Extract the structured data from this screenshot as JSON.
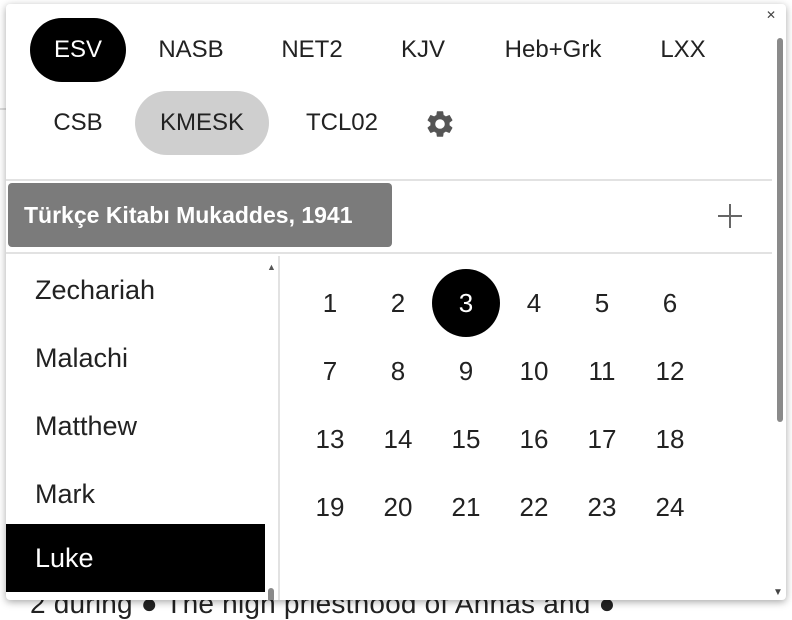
{
  "background": {
    "text": "2 during ● The high priesthood of Annas and ●"
  },
  "translations": [
    {
      "label": "ESV",
      "state": "active"
    },
    {
      "label": "NASB",
      "state": ""
    },
    {
      "label": "NET2",
      "state": ""
    },
    {
      "label": "KJV",
      "state": ""
    },
    {
      "label": "Heb+Grk",
      "state": ""
    },
    {
      "label": "LXX",
      "state": ""
    },
    {
      "label": "CSB",
      "state": ""
    },
    {
      "label": "KMESK",
      "state": "selected"
    },
    {
      "label": "TCL02",
      "state": ""
    }
  ],
  "version_title": "Türkçe Kitabı Mukaddes, 1941",
  "books": [
    {
      "label": "Zechariah"
    },
    {
      "label": "Malachi"
    },
    {
      "label": "Matthew"
    },
    {
      "label": "Mark"
    },
    {
      "label": "Luke",
      "active": true
    }
  ],
  "chapters": [
    "1",
    "2",
    "3",
    "4",
    "5",
    "6",
    "7",
    "8",
    "9",
    "10",
    "11",
    "12",
    "13",
    "14",
    "15",
    "16",
    "17",
    "18",
    "19",
    "20",
    "21",
    "22",
    "23",
    "24"
  ],
  "selected_chapter": "3",
  "icons": {
    "settings": "gear-icon",
    "add": "plus-icon",
    "close": "close-icon"
  },
  "colors": {
    "active": "#000000",
    "selected": "#cfcfcf",
    "version_chip": "#7b7b7b"
  }
}
